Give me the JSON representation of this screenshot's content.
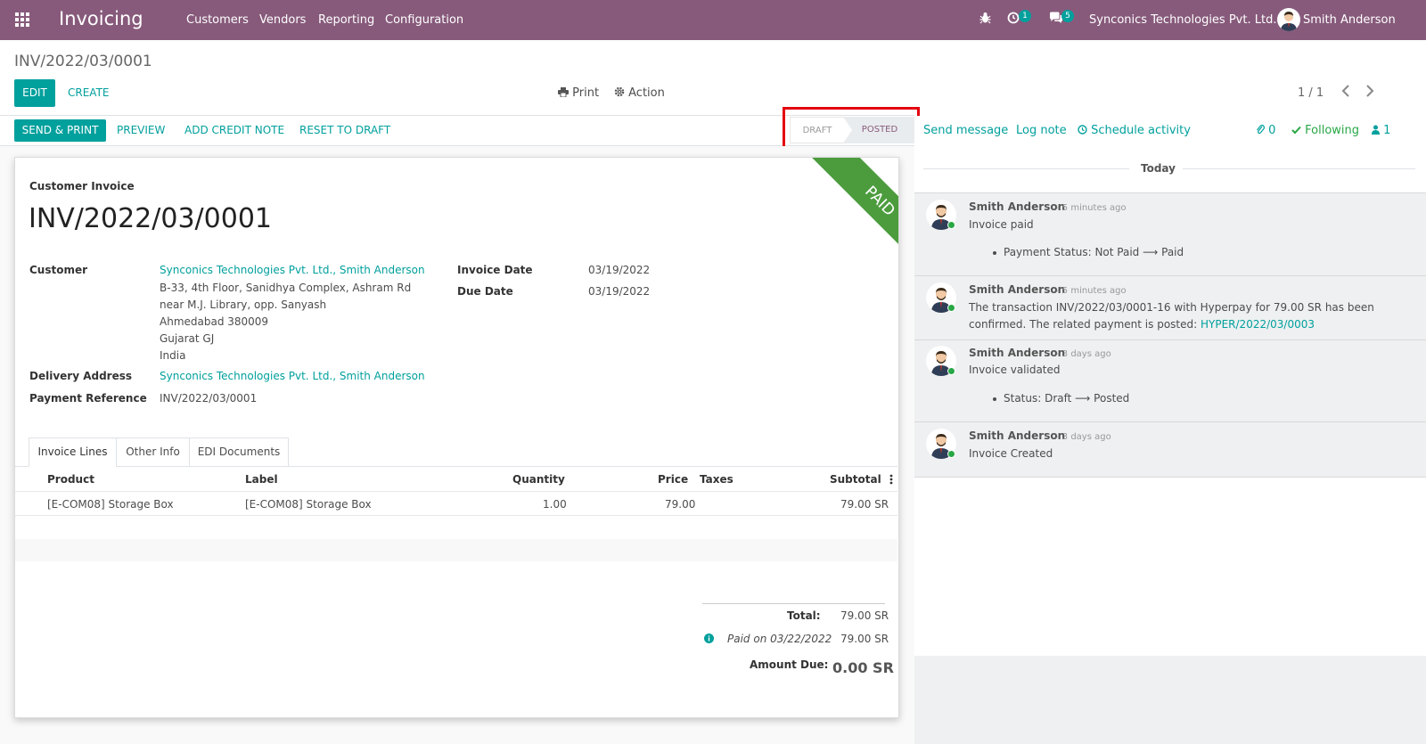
{
  "navbar": {
    "brand": "Invoicing",
    "menu": [
      "Customers",
      "Vendors",
      "Reporting",
      "Configuration"
    ],
    "activity_count": "1",
    "message_count": "5",
    "company": "Synconics Technologies Pvt. Ltd.",
    "user": "Smith Anderson"
  },
  "control": {
    "breadcrumb": "INV/2022/03/0001",
    "edit": "EDIT",
    "create": "CREATE",
    "print": "Print",
    "action": "Action",
    "pager": "1 / 1"
  },
  "statusbar": {
    "buttons": [
      "SEND & PRINT",
      "PREVIEW",
      "ADD CREDIT NOTE",
      "RESET TO DRAFT"
    ],
    "stages": [
      "DRAFT",
      "POSTED"
    ]
  },
  "invoice": {
    "type_label": "Customer Invoice",
    "number": "INV/2022/03/0001",
    "ribbon": "PAID",
    "customer_label": "Customer",
    "customer_name": "Synconics Technologies Pvt. Ltd., Smith Anderson",
    "address": [
      "B-33, 4th Floor, Sanidhya Complex, Ashram Rd",
      "near M.J. Library, opp. Sanyash",
      "Ahmedabad 380009",
      "Gujarat GJ",
      "India"
    ],
    "delivery_label": "Delivery Address",
    "delivery_value": "Synconics Technologies Pvt. Ltd., Smith Anderson",
    "payref_label": "Payment Reference",
    "payref_value": "INV/2022/03/0001",
    "invoice_date_label": "Invoice Date",
    "invoice_date": "03/19/2022",
    "due_date_label": "Due Date",
    "due_date": "03/19/2022"
  },
  "tabs": [
    "Invoice Lines",
    "Other Info",
    "EDI Documents"
  ],
  "lines": {
    "headers": [
      "Product",
      "Label",
      "Quantity",
      "Price",
      "Taxes",
      "Subtotal"
    ],
    "rows": [
      {
        "product": "[E-COM08] Storage Box",
        "label": "[E-COM08] Storage Box",
        "quantity": "1.00",
        "price": "79.00",
        "taxes": "",
        "subtotal": "79.00 SR"
      }
    ]
  },
  "totals": {
    "total_label": "Total:",
    "total_value": "79.00 SR",
    "paid_label": "Paid on 03/22/2022",
    "paid_value": "79.00 SR",
    "due_label": "Amount Due:",
    "due_value": "0.00 SR"
  },
  "chatter": {
    "send_message": "Send message",
    "log_note": "Log note",
    "schedule": "Schedule activity",
    "attachments": "0",
    "following": "Following",
    "followers": "1",
    "today": "Today",
    "messages": [
      {
        "author": "Smith Anderson",
        "time": "- 5 minutes ago",
        "body": "Invoice paid",
        "bullet": "Payment Status: Not Paid ⟶ Paid"
      },
      {
        "author": "Smith Anderson",
        "time": "- 5 minutes ago",
        "body1": "The transaction INV/2022/03/0001-16 with Hyperpay for 79.00 SR has been",
        "body2": "confirmed. The related payment is posted:",
        "link": "HYPER/2022/03/0003"
      },
      {
        "author": "Smith Anderson",
        "time": "- 3 days ago",
        "body": "Invoice validated",
        "bullet": "Status: Draft ⟶ Posted"
      },
      {
        "author": "Smith Anderson",
        "time": "- 3 days ago",
        "body": "Invoice Created"
      }
    ]
  },
  "colors": {
    "brand": "#875a7b",
    "accent": "#00a09d",
    "ribbon": "#4c9c3e",
    "highlight": "#e3000f"
  }
}
